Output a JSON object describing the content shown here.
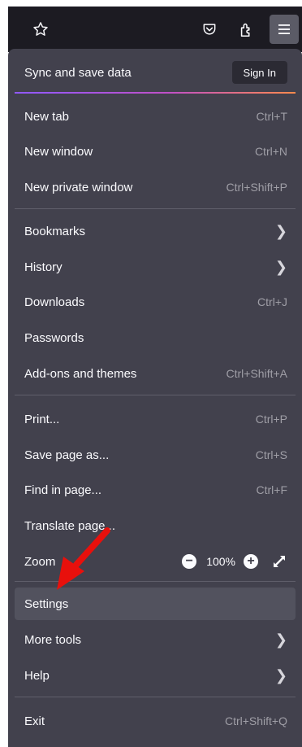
{
  "toolbar": {
    "icons": [
      "star-icon",
      "pocket-icon",
      "extensions-icon",
      "hamburger-menu-icon"
    ]
  },
  "menu": {
    "sync": {
      "label": "Sync and save data",
      "sign_in": "Sign In"
    },
    "items": [
      {
        "label": "New tab",
        "shortcut": "Ctrl+T"
      },
      {
        "label": "New window",
        "shortcut": "Ctrl+N"
      },
      {
        "label": "New private window",
        "shortcut": "Ctrl+Shift+P"
      },
      {
        "label": "Bookmarks",
        "shortcut": ""
      },
      {
        "label": "History",
        "shortcut": ""
      },
      {
        "label": "Downloads",
        "shortcut": "Ctrl+J"
      },
      {
        "label": "Passwords",
        "shortcut": ""
      },
      {
        "label": "Add-ons and themes",
        "shortcut": "Ctrl+Shift+A"
      },
      {
        "label": "Print...",
        "shortcut": "Ctrl+P"
      },
      {
        "label": "Save page as...",
        "shortcut": "Ctrl+S"
      },
      {
        "label": "Find in page...",
        "shortcut": "Ctrl+F"
      },
      {
        "label": "Translate page...",
        "shortcut": ""
      },
      {
        "label": "Zoom",
        "shortcut": ""
      },
      {
        "label": "Settings",
        "shortcut": ""
      },
      {
        "label": "More tools",
        "shortcut": ""
      },
      {
        "label": "Help",
        "shortcut": ""
      },
      {
        "label": "Exit",
        "shortcut": "Ctrl+Shift+Q"
      }
    ],
    "zoom": {
      "minus": "−",
      "value": "100%",
      "plus": "+"
    }
  },
  "colors": {
    "panel": "#42414d",
    "toolbar": "#1c1b22",
    "highlight": "#52525e",
    "annotation_arrow": "#e8100c"
  }
}
